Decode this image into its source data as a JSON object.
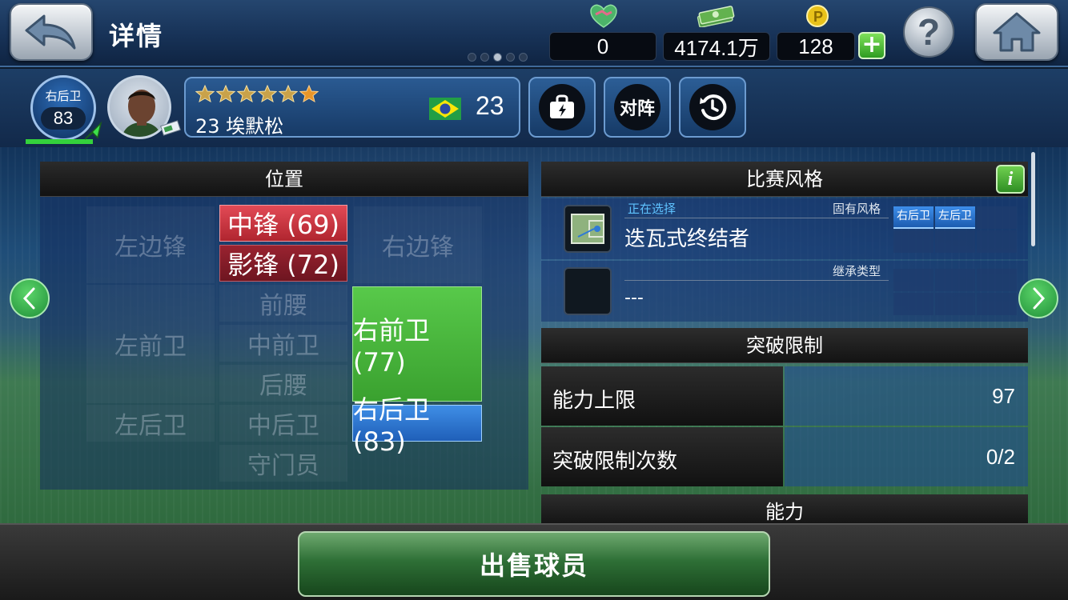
{
  "header": {
    "title": "详情",
    "pager": {
      "total": 5,
      "current": 3
    },
    "resources": [
      {
        "icon": "handshake-icon",
        "value": "0"
      },
      {
        "icon": "money-stack-icon",
        "value": "4174.1万"
      },
      {
        "icon": "coin-p-icon",
        "value": "128"
      }
    ]
  },
  "player": {
    "position": "右后卫",
    "rating": "83",
    "stars": 6,
    "name": "23 埃默松",
    "nationality_icon": "brazil-flag-icon",
    "age": "23",
    "actions": [
      {
        "icon": "contract-bag-icon",
        "label": ""
      },
      {
        "icon": "",
        "label": "对阵"
      },
      {
        "icon": "history-clock-icon",
        "label": ""
      }
    ]
  },
  "positions": {
    "header": "位置",
    "grid": {
      "lw": "左边锋",
      "rw": "右边锋",
      "amf": "前腰",
      "lmf": "左前卫",
      "cmf": "中前卫",
      "dmf": "后腰",
      "lb": "左后卫",
      "cb": "中后卫",
      "gk": "守门员"
    },
    "chips": {
      "cf": "中锋 (69)",
      "ss": "影锋 (72)",
      "rmf": "右前卫 (77)",
      "rb": "右后卫 (83)"
    }
  },
  "playstyle": {
    "header": "比赛风格",
    "selected_tag": "正在选择",
    "fixed_label": "固有风格",
    "style_name": "迭瓦式终结者",
    "inherit_label": "继承类型",
    "inherit_value": "---",
    "style_positions": [
      "右后卫",
      "左后卫"
    ]
  },
  "limit_break": {
    "header": "突破限制",
    "rows": [
      {
        "label": "能力上限",
        "value": "97"
      },
      {
        "label": "突破限制次数",
        "value": "0/2"
      }
    ]
  },
  "ability": {
    "header": "能力"
  },
  "footer": {
    "sell_label": "出售球员"
  },
  "colors": {
    "forward_red": "#c8323f",
    "forward_dark_red": "#8a1d28",
    "midfield_green": "#46b13a",
    "defense_blue": "#2f7ad6",
    "accent_green": "#34d13c"
  }
}
